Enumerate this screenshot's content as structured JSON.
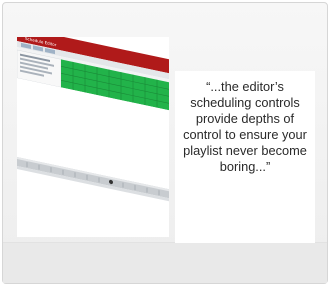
{
  "quote": {
    "text": "“...the editor’s scheduling controls provide depths of control to ensure your playlist never become boring...”"
  },
  "screenshot": {
    "window_title": "Schedule Editor",
    "titlebar_color": "#b01a1a",
    "grid_color": "#22b34a",
    "timeline_color": "#c8ccd0"
  }
}
